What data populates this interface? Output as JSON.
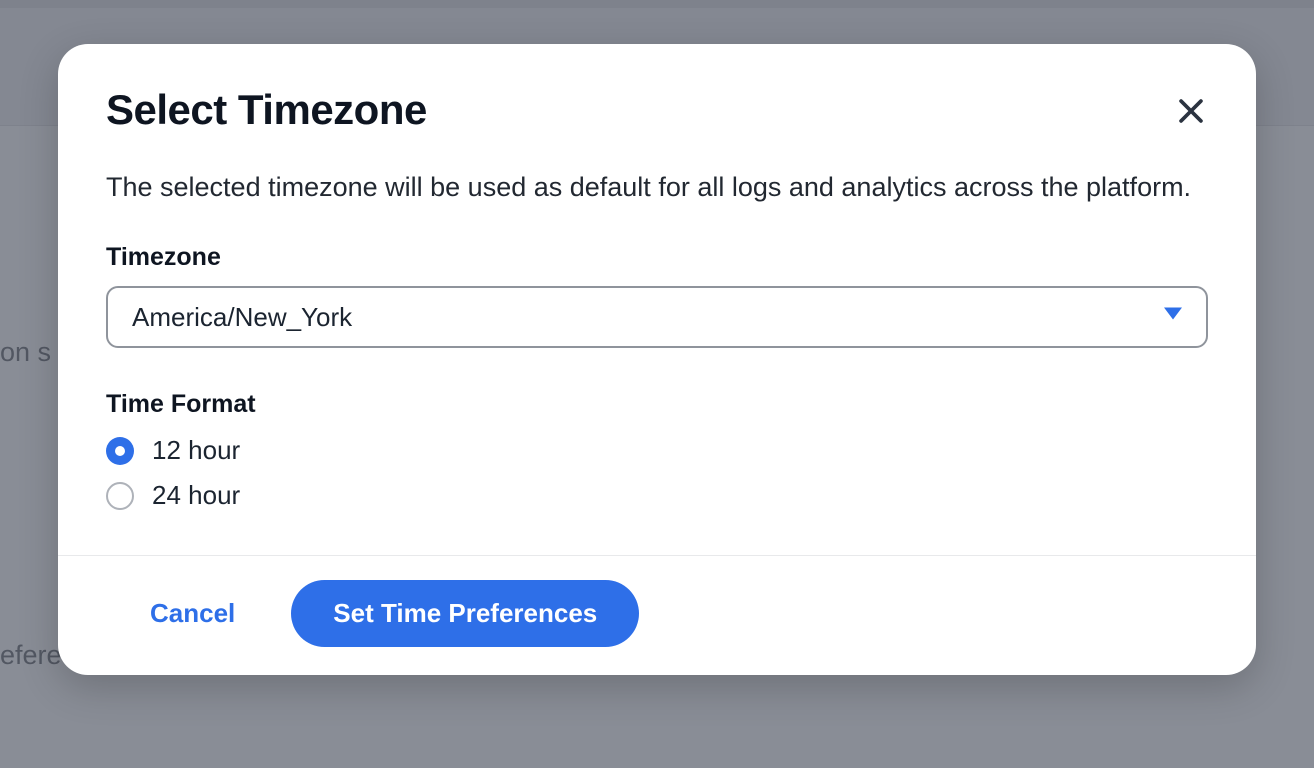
{
  "background": {
    "partial_text_1": "on s",
    "partial_text_2": "efere"
  },
  "dialog": {
    "title": "Select Timezone",
    "description": "The selected timezone will be used as default for all logs and analytics across the platform.",
    "timezone": {
      "label": "Timezone",
      "selected": "America/New_York"
    },
    "time_format": {
      "label": "Time Format",
      "options": [
        {
          "label": "12 hour",
          "checked": true
        },
        {
          "label": "24 hour",
          "checked": false
        }
      ]
    },
    "footer": {
      "cancel": "Cancel",
      "submit": "Set Time Preferences"
    }
  }
}
